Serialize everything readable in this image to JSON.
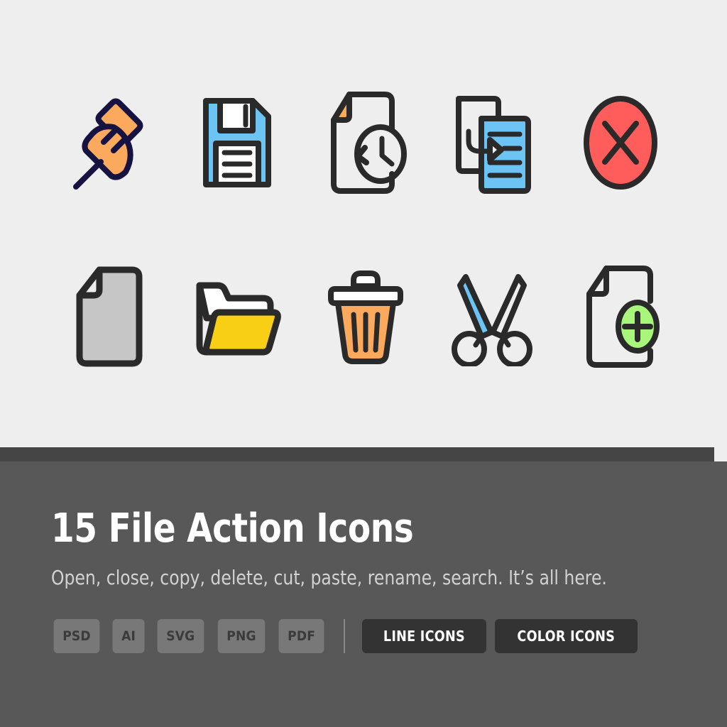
{
  "theme": {
    "background": "#EEEEEE",
    "panel_background": "#585858",
    "strip_background": "#454545",
    "title_color": "#FFFFFF",
    "subtitle_color": "#D2D2D2",
    "badge_background": "#787878",
    "badge_text_color": "#3B3B3B",
    "button_background": "#333333",
    "button_text_color": "#FFFFFF",
    "ink": "#2A2A2A",
    "navy": "#161342",
    "orange": "#FBA95C",
    "blue": "#6CC4F5",
    "red": "#FF5C5C",
    "yellow": "#F8CF14",
    "green": "#A8F67A",
    "gray_fill": "#C6C6C6"
  },
  "panel": {
    "title": "15 File Action Icons",
    "subtitle": "Open, close, copy, delete, cut, paste, rename, search. It’s all here.",
    "formats": [
      "PSD",
      "AI",
      "SVG",
      "PNG",
      "PDF"
    ],
    "buttons": [
      {
        "label": "LINE ICONS"
      },
      {
        "label": "COLOR ICONS"
      }
    ]
  },
  "showcase": {
    "icons": [
      {
        "name": "pushpin-icon",
        "label": "Pushpin"
      },
      {
        "name": "floppy-save-icon",
        "label": "Save"
      },
      {
        "name": "file-history-icon",
        "label": "File history"
      },
      {
        "name": "paste-document-icon",
        "label": "Paste"
      },
      {
        "name": "close-x-icon",
        "label": "Close"
      },
      {
        "name": "file-icon",
        "label": "File"
      },
      {
        "name": "open-folder-icon",
        "label": "Open folder"
      },
      {
        "name": "trash-can-icon",
        "label": "Delete"
      },
      {
        "name": "scissors-cut-icon",
        "label": "Cut"
      },
      {
        "name": "new-file-icon",
        "label": "New file"
      }
    ]
  }
}
